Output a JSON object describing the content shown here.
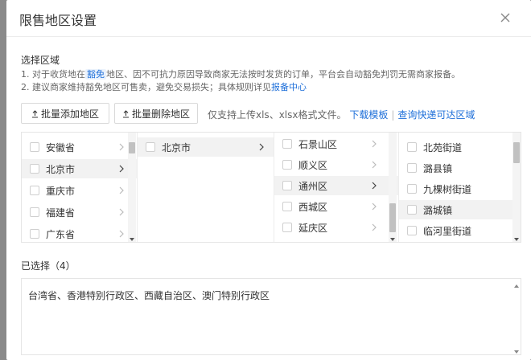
{
  "dialog": {
    "title": "限售地区设置",
    "close_icon": "close-icon"
  },
  "section": {
    "label": "选择区域",
    "tip1_prefix": "1. 对于收货地在",
    "tip1_tag": "豁免",
    "tip1_suffix": "地区、因不可抗力原因导致商家无法按时发货的订单，平台会自动豁免判罚无需商家报备。",
    "tip2_prefix": "2. 建议商家维持豁免地区可售卖，避免交易损失；具体规则详见",
    "tip2_link": "报备中心"
  },
  "toolbar": {
    "add_label": "批量添加地区",
    "delete_label": "批量删除地区",
    "support_text": "仅支持上传xls、xlsx格式文件。",
    "download_link": "下载模板",
    "query_link": "查询快递可达区域"
  },
  "picker": {
    "provinces": [
      {
        "label": "安徽省",
        "active": false
      },
      {
        "label": "北京市",
        "active": true
      },
      {
        "label": "重庆市",
        "active": false
      },
      {
        "label": "福建省",
        "active": false
      },
      {
        "label": "广东省",
        "active": false
      }
    ],
    "cities": [
      {
        "label": "北京市",
        "active": true
      }
    ],
    "districts": [
      {
        "label": "石景山区",
        "active": false
      },
      {
        "label": "顺义区",
        "active": false
      },
      {
        "label": "通州区",
        "active": true
      },
      {
        "label": "西城区",
        "active": false
      },
      {
        "label": "延庆区",
        "active": false
      }
    ],
    "streets": [
      {
        "label": "北苑街道",
        "active": false
      },
      {
        "label": "潞县镇",
        "active": false
      },
      {
        "label": "九棵树街道",
        "active": false
      },
      {
        "label": "潞城镇",
        "active": true
      },
      {
        "label": "临河里街道",
        "active": false
      }
    ]
  },
  "selected": {
    "label": "已选择（4）",
    "content": "台湾省、香港特别行政区、西藏自治区、澳门特别行政区"
  },
  "colors": {
    "link": "#1e6fd9",
    "overlay": "#8a8a8a",
    "active_row": "#f2f2f2"
  }
}
